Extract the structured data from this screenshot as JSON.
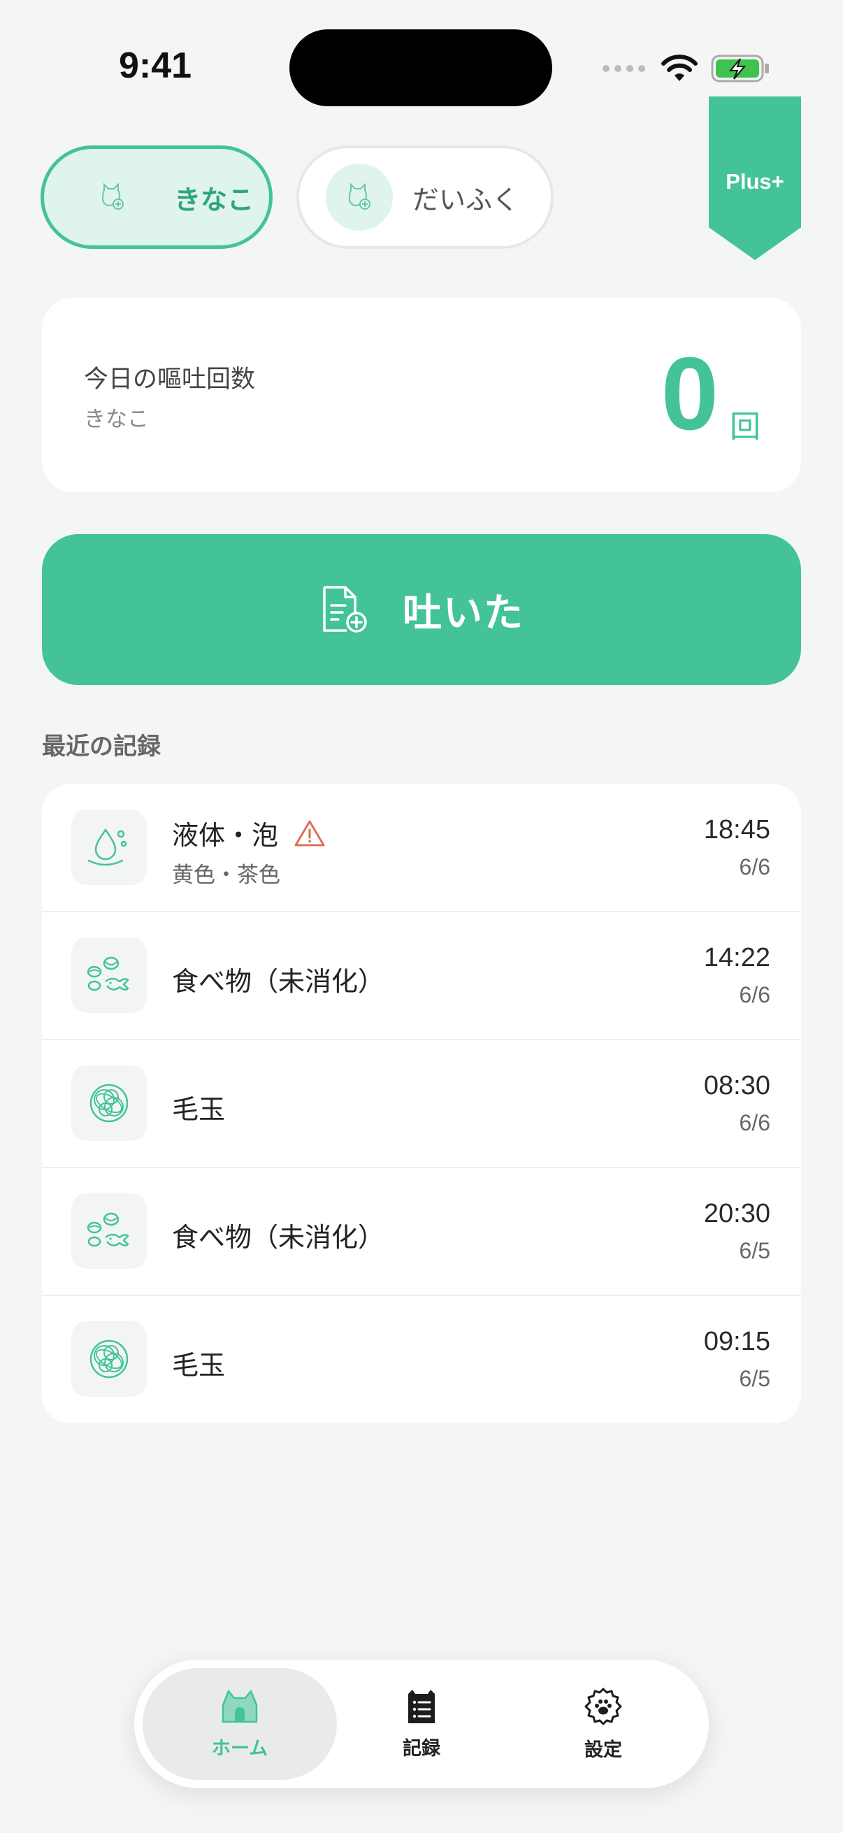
{
  "status_bar": {
    "time": "9:41"
  },
  "cats": [
    {
      "name": "きなこ",
      "selected": true
    },
    {
      "name": "だいふく",
      "selected": false
    }
  ],
  "plus_badge": "Plus+",
  "today": {
    "title": "今日の嘔吐回数",
    "cat_name": "きなこ",
    "count": "0",
    "unit": "回"
  },
  "action_button": {
    "label": "吐いた"
  },
  "recent": {
    "title": "最近の記録",
    "items": [
      {
        "type": "液体・泡",
        "detail": "黄色・茶色",
        "warning": true,
        "icon": "droplet-icon",
        "time": "18:45",
        "date": "6/6"
      },
      {
        "type": "食べ物（未消化）",
        "detail": "",
        "warning": false,
        "icon": "food-icon",
        "time": "14:22",
        "date": "6/6"
      },
      {
        "type": "毛玉",
        "detail": "",
        "warning": false,
        "icon": "hairball-icon",
        "time": "08:30",
        "date": "6/6"
      },
      {
        "type": "食べ物（未消化）",
        "detail": "",
        "warning": false,
        "icon": "food-icon",
        "time": "20:30",
        "date": "6/5"
      },
      {
        "type": "毛玉",
        "detail": "",
        "warning": false,
        "icon": "hairball-icon",
        "time": "09:15",
        "date": "6/5"
      }
    ]
  },
  "tabs": [
    {
      "label": "ホーム",
      "icon": "cat-house-icon",
      "active": true
    },
    {
      "label": "記録",
      "icon": "notebook-icon",
      "active": false
    },
    {
      "label": "設定",
      "icon": "paw-gear-icon",
      "active": false
    }
  ],
  "colors": {
    "accent": "#43c397",
    "accent_light": "#dff4ec",
    "warning": "#e06a4f",
    "background": "#f4f6f5"
  }
}
